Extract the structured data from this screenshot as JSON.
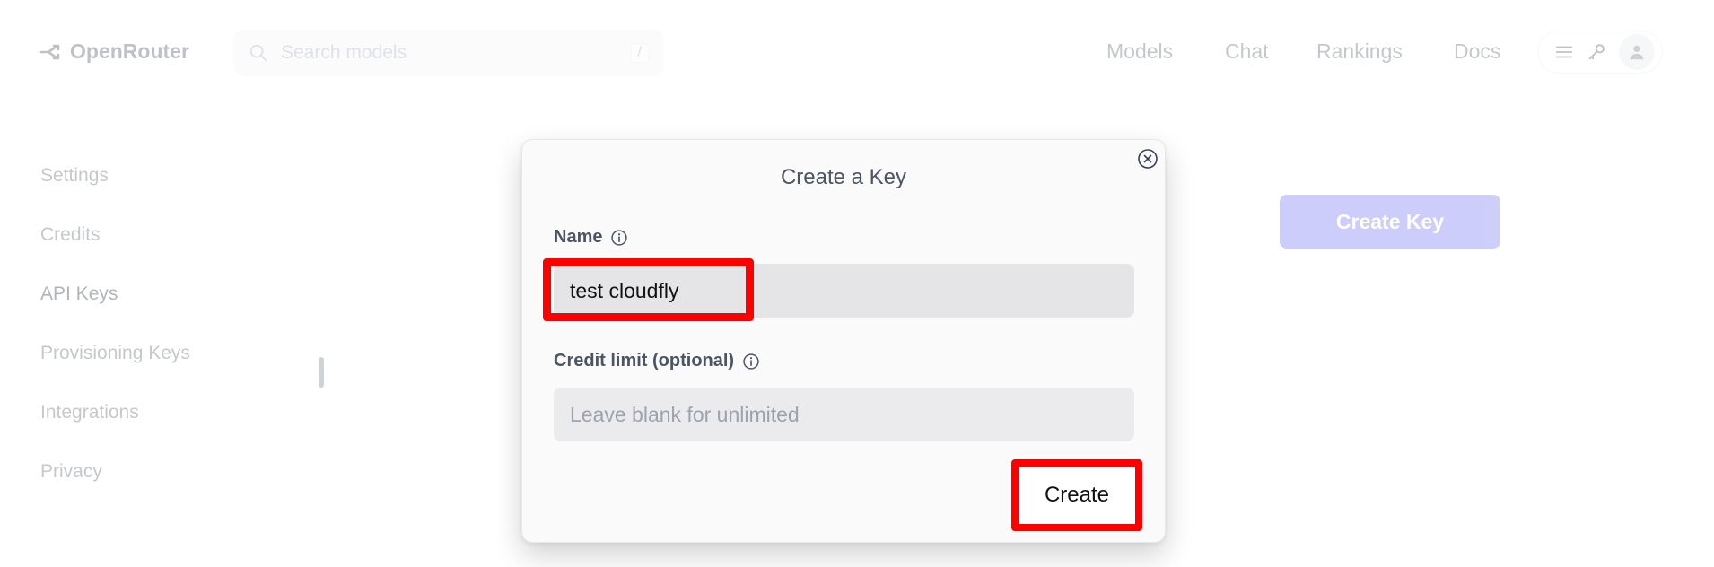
{
  "brand": {
    "name": "OpenRouter",
    "icon": "openrouter-logo-icon"
  },
  "search": {
    "placeholder": "Search models",
    "shortcut": "/"
  },
  "nav": {
    "items": [
      "Models",
      "Chat",
      "Rankings",
      "Docs"
    ]
  },
  "header_icons": [
    "menu-icon",
    "key-icon",
    "avatar"
  ],
  "sidebar": {
    "items": [
      {
        "label": "Settings"
      },
      {
        "label": "Credits"
      },
      {
        "label": "API Keys",
        "active": true
      },
      {
        "label": "Provisioning Keys"
      },
      {
        "label": "Integrations"
      },
      {
        "label": "Privacy"
      }
    ]
  },
  "page": {
    "create_key_label": "Create Key"
  },
  "modal": {
    "title": "Create a Key",
    "name_label": "Name",
    "name_value": "test cloudfly",
    "credit_label": "Credit limit (optional)",
    "credit_placeholder": "Leave blank for unlimited",
    "create_label": "Create"
  },
  "colors": {
    "accent": "#6366f1",
    "highlight": "#ff0000",
    "text": "#4b5563"
  }
}
